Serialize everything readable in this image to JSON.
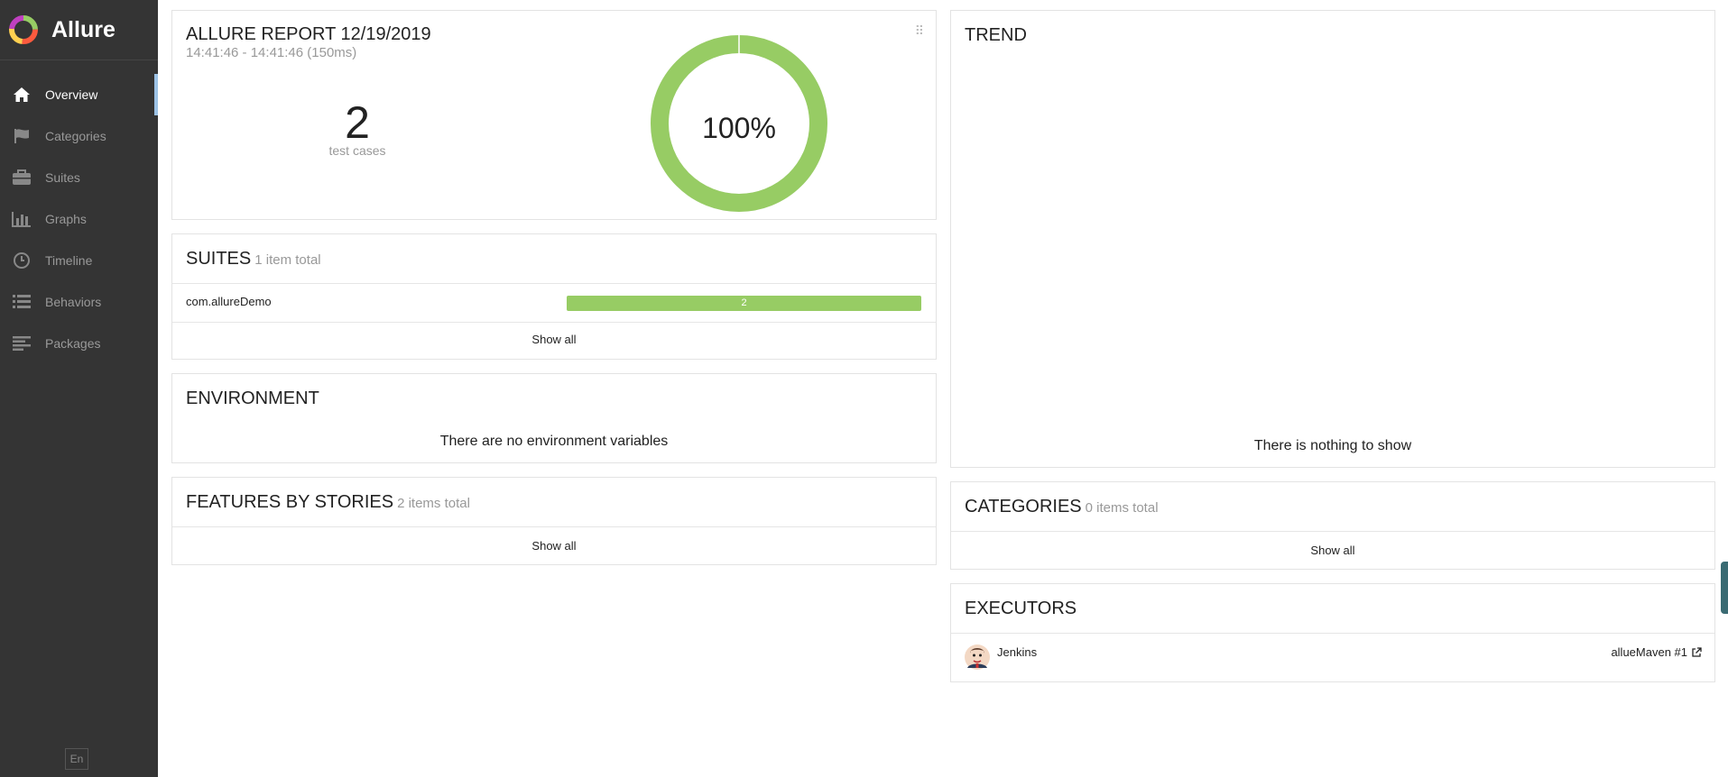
{
  "app": {
    "name": "Allure"
  },
  "sidebar": {
    "items": [
      {
        "label": "Overview",
        "icon": "home-icon"
      },
      {
        "label": "Categories",
        "icon": "flag-icon"
      },
      {
        "label": "Suites",
        "icon": "briefcase-icon"
      },
      {
        "label": "Graphs",
        "icon": "bar-chart-icon"
      },
      {
        "label": "Timeline",
        "icon": "clock-icon"
      },
      {
        "label": "Behaviors",
        "icon": "list-icon"
      },
      {
        "label": "Packages",
        "icon": "align-left-icon"
      }
    ],
    "active_index": 0,
    "language": "En"
  },
  "summary": {
    "title": "ALLURE REPORT 12/19/2019",
    "time": "14:41:46 - 14:41:46 (150ms)",
    "count": "2",
    "count_label": "test cases",
    "percent": "100%",
    "passed_fraction": 1.0,
    "passed_color": "#97cc64"
  },
  "suites": {
    "title": "SUITES",
    "count": "1 item total",
    "rows": [
      {
        "name": "com.allureDemo",
        "passed": "2",
        "passed_fraction": 1.0
      }
    ],
    "show_all": "Show all"
  },
  "environment": {
    "title": "ENVIRONMENT",
    "message": "There are no environment variables"
  },
  "features": {
    "title": "FEATURES BY STORIES",
    "count": "2 items total",
    "show_all": "Show all"
  },
  "trend": {
    "title": "TREND",
    "message": "There is nothing to show"
  },
  "categories": {
    "title": "CATEGORIES",
    "count": "0 items total",
    "show_all": "Show all"
  },
  "executors": {
    "title": "EXECUTORS",
    "items": [
      {
        "name": "Jenkins",
        "build": "allueMaven #1",
        "icon": "jenkins-avatar"
      }
    ]
  }
}
